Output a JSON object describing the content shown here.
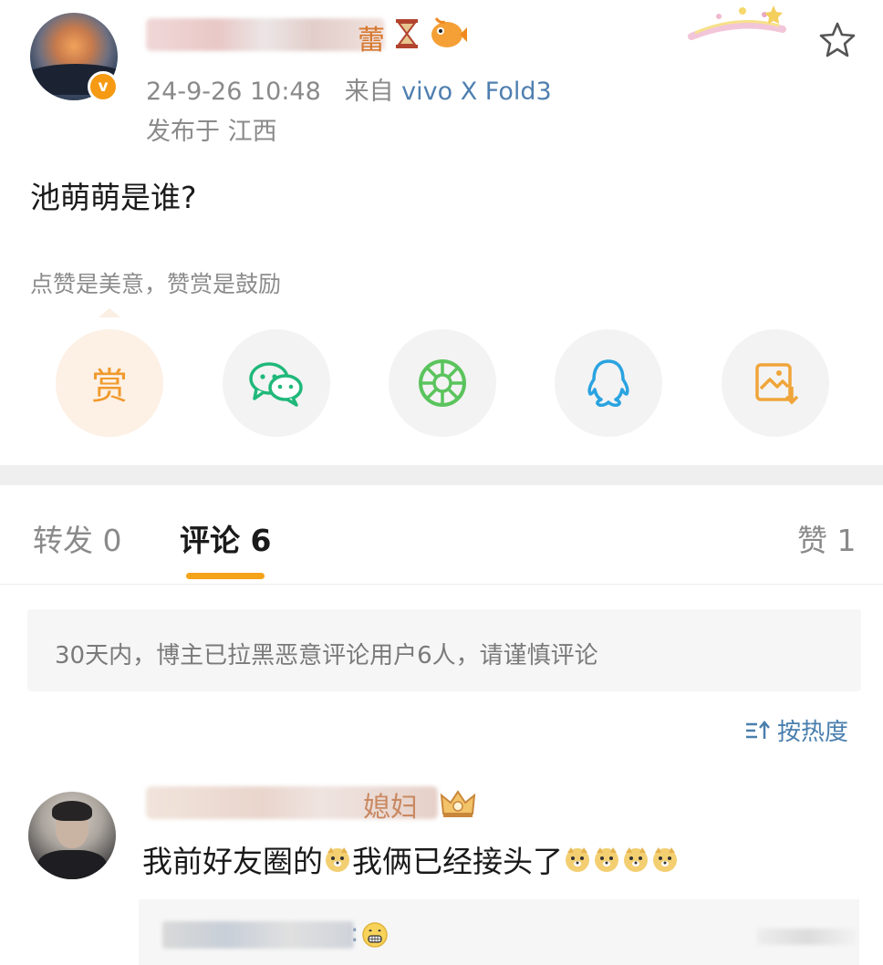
{
  "post": {
    "author_name_char": "蕾",
    "meta_time": "24-9-26 10:48",
    "meta_from": "来自",
    "meta_device": "vivo X Fold3",
    "location": "发布于 江西",
    "text": "池萌萌是谁?",
    "reward_hint": "点赞是美意，赞赏是鼓励",
    "reward_label": "赏"
  },
  "share_icons": [
    "reward-icon",
    "wechat-icon",
    "moments-icon",
    "qq-icon",
    "save-image-icon"
  ],
  "tabs": {
    "repost": "转发 0",
    "comments": "评论 6",
    "likes": "赞 1"
  },
  "notice": "30天内，博主已拉黑恶意评论用户6人，请谨慎评论",
  "sort": {
    "label": "按热度"
  },
  "comment": {
    "name_char": "媳妇",
    "text_a": "我前好友圈的",
    "text_b": "我俩已经接头了",
    "reply_colon": ":"
  },
  "colors": {
    "accent": "#f5a31a",
    "link": "#4f7fb0",
    "verified": "#f59a12"
  }
}
